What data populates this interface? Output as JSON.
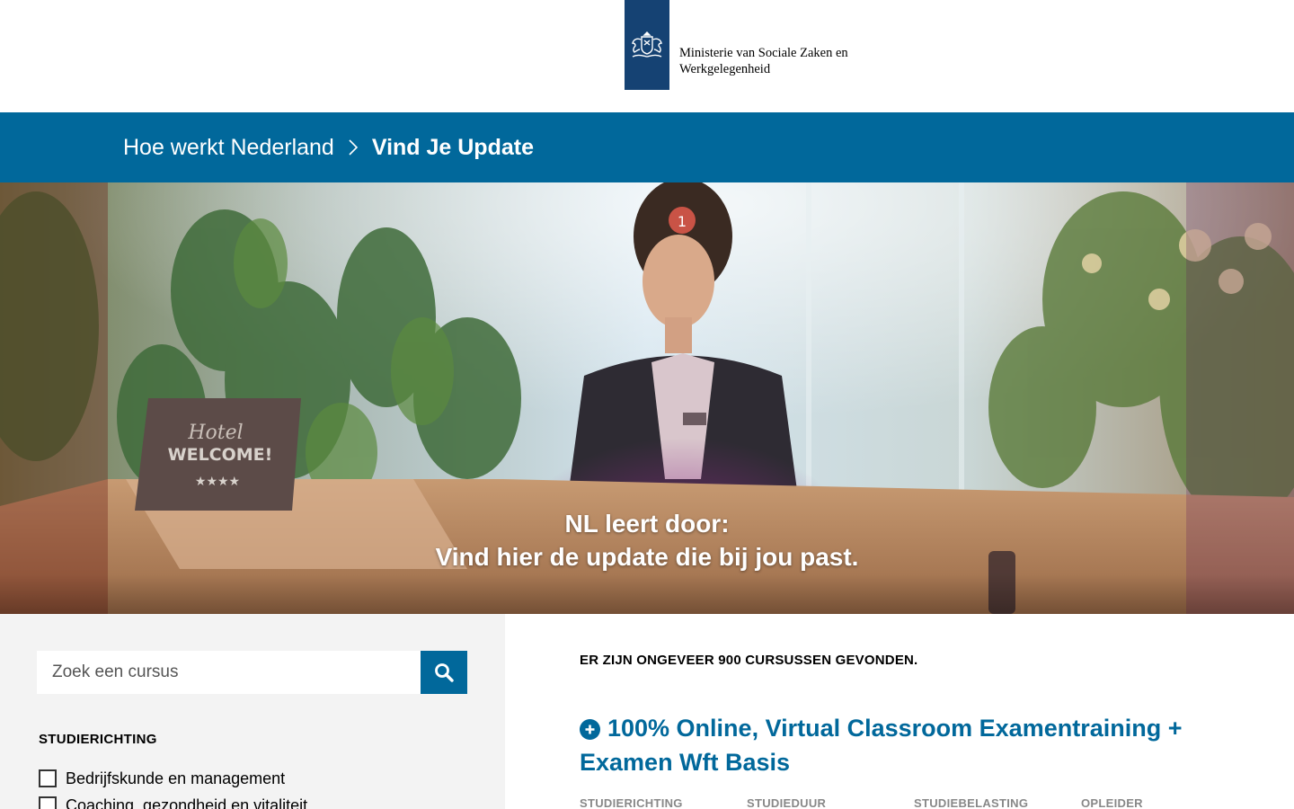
{
  "header": {
    "logo_line1": "Ministerie van Sociale Zaken en",
    "logo_line2": "Werkgelegenheid",
    "logo_icon": "coat-of-arms-icon"
  },
  "breadcrumb": {
    "home": "Hoe werkt Nederland",
    "current": "Vind Je Update",
    "separator_icon": "chevron-right-icon"
  },
  "hero": {
    "title_line1": "NL leert door:",
    "title_line2": "Vind hier de update die bij jou past.",
    "badge": "1",
    "desk_sign_line1": "Hotel",
    "desk_sign_line2": "WELCOME!",
    "desk_sign_stars": "★★★★"
  },
  "sidebar": {
    "search_placeholder": "Zoek een cursus",
    "search_icon": "search-icon",
    "facet_title": "STUDIERICHTING",
    "facets": [
      {
        "label": "Bedrijfskunde en management"
      },
      {
        "label": "Coaching, gezondheid en vitaliteit"
      }
    ]
  },
  "results": {
    "count_text": "ER ZIJN ONGEVEER 900 CURSUSSEN GEVONDEN.",
    "items": [
      {
        "title": "100% Online, Virtual Classroom Examentraining + Examen Wft Basis",
        "meta_headers": [
          "STUDIERICHTING",
          "STUDIEDUUR",
          "STUDIEBELASTING",
          "OPLEIDER"
        ]
      }
    ]
  },
  "colors": {
    "primary_blue": "#01689b",
    "logo_blue": "#154273",
    "sidebar_bg": "#f3f3f3"
  }
}
